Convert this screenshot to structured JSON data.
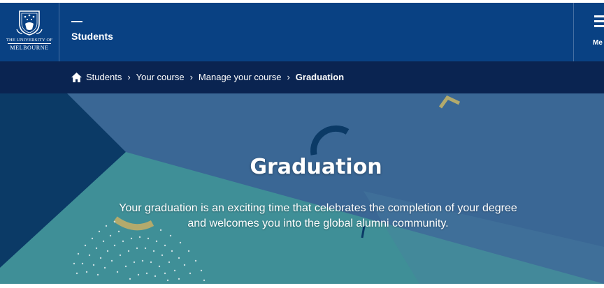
{
  "header": {
    "logo": {
      "line1": "THE UNIVERSITY OF",
      "line2": "MELBOURNE"
    },
    "site_title": "Students",
    "menu_label": "Menu",
    "menu_label_visible": "Me",
    "colors": {
      "header_bg": "#094183",
      "breadcrumb_bg": "#0a2451"
    }
  },
  "breadcrumb": {
    "items": [
      {
        "label": "Students",
        "icon": "home-icon"
      },
      {
        "label": "Your course"
      },
      {
        "label": "Manage your course"
      },
      {
        "label": "Graduation",
        "current": true
      }
    ],
    "separator": "›"
  },
  "hero": {
    "title": "Graduation",
    "subtitle_line1": "Your graduation is an exciting time that celebrates the completion of your degree",
    "subtitle_line2": "and welcomes you into the global alumni community.",
    "colors": {
      "dark_navy": "#0b3a66",
      "teal": "#3f8f97",
      "slate_blue": "#3a6795",
      "gold": "#b3aa6c"
    }
  }
}
